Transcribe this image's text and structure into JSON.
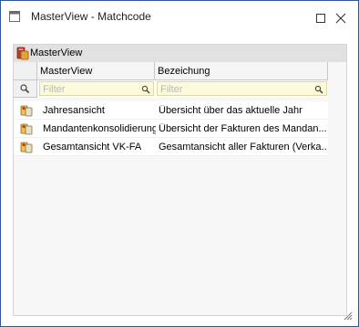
{
  "window": {
    "title": "MasterView - Matchcode"
  },
  "panel": {
    "group_caption": "MasterView"
  },
  "grid": {
    "columns": [
      {
        "label": "MasterView"
      },
      {
        "label": "Bezeichung"
      }
    ],
    "filter_placeholder": "Filter",
    "rows": [
      {
        "masterview": "Jahresansicht",
        "bezeichnung": "Übersicht über das aktuelle Jahr"
      },
      {
        "masterview": "Mandantenkonsolidierung",
        "bezeichnung": "Übersicht der Fakturen des Mandan..."
      },
      {
        "masterview": "Gesamtansicht VK-FA",
        "bezeichnung": "Gesamtansicht aller Fakturen (Verka..."
      }
    ]
  },
  "colors": {
    "window_border": "#2b579a",
    "filter_background": "#fbfbdc",
    "header_background": "#e1e1e1"
  }
}
